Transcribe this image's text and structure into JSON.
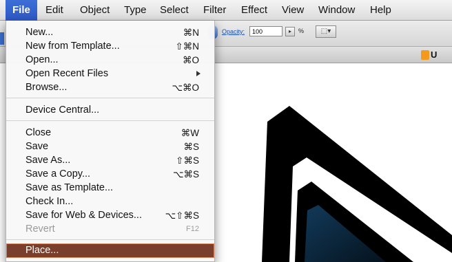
{
  "menubar": {
    "items": [
      "File",
      "Edit",
      "Object",
      "Type",
      "Select",
      "Filter",
      "Effect",
      "View",
      "Window",
      "Help"
    ]
  },
  "controlbar": {
    "opacity_label": "Opacity:",
    "opacity_value": "100",
    "percent": "%"
  },
  "document_tab": {
    "label": "U"
  },
  "file_menu": {
    "items": [
      {
        "label": "New...",
        "shortcut": "⌘N"
      },
      {
        "label": "New from Template...",
        "shortcut": "⇧⌘N"
      },
      {
        "label": "Open...",
        "shortcut": "⌘O"
      },
      {
        "label": "Open Recent Files",
        "shortcut": ""
      },
      {
        "label": "Browse...",
        "shortcut": "⌥⌘O"
      },
      {
        "label": "Device Central...",
        "shortcut": ""
      },
      {
        "label": "Close",
        "shortcut": "⌘W"
      },
      {
        "label": "Save",
        "shortcut": "⌘S"
      },
      {
        "label": "Save As...",
        "shortcut": "⇧⌘S"
      },
      {
        "label": "Save a Copy...",
        "shortcut": "⌥⌘S"
      },
      {
        "label": "Save as Template...",
        "shortcut": ""
      },
      {
        "label": "Check In...",
        "shortcut": ""
      },
      {
        "label": "Save for Web & Devices...",
        "shortcut": "⌥⇧⌘S"
      },
      {
        "label": "Revert",
        "shortcut": "F12"
      },
      {
        "label": "Place...",
        "shortcut": ""
      }
    ]
  },
  "colors": {
    "menubar_active": "#2e57c4",
    "menu_highlight": "#7a3f2c",
    "canvas_shape": "#000000",
    "canvas_gradient": "#0d4a72"
  }
}
